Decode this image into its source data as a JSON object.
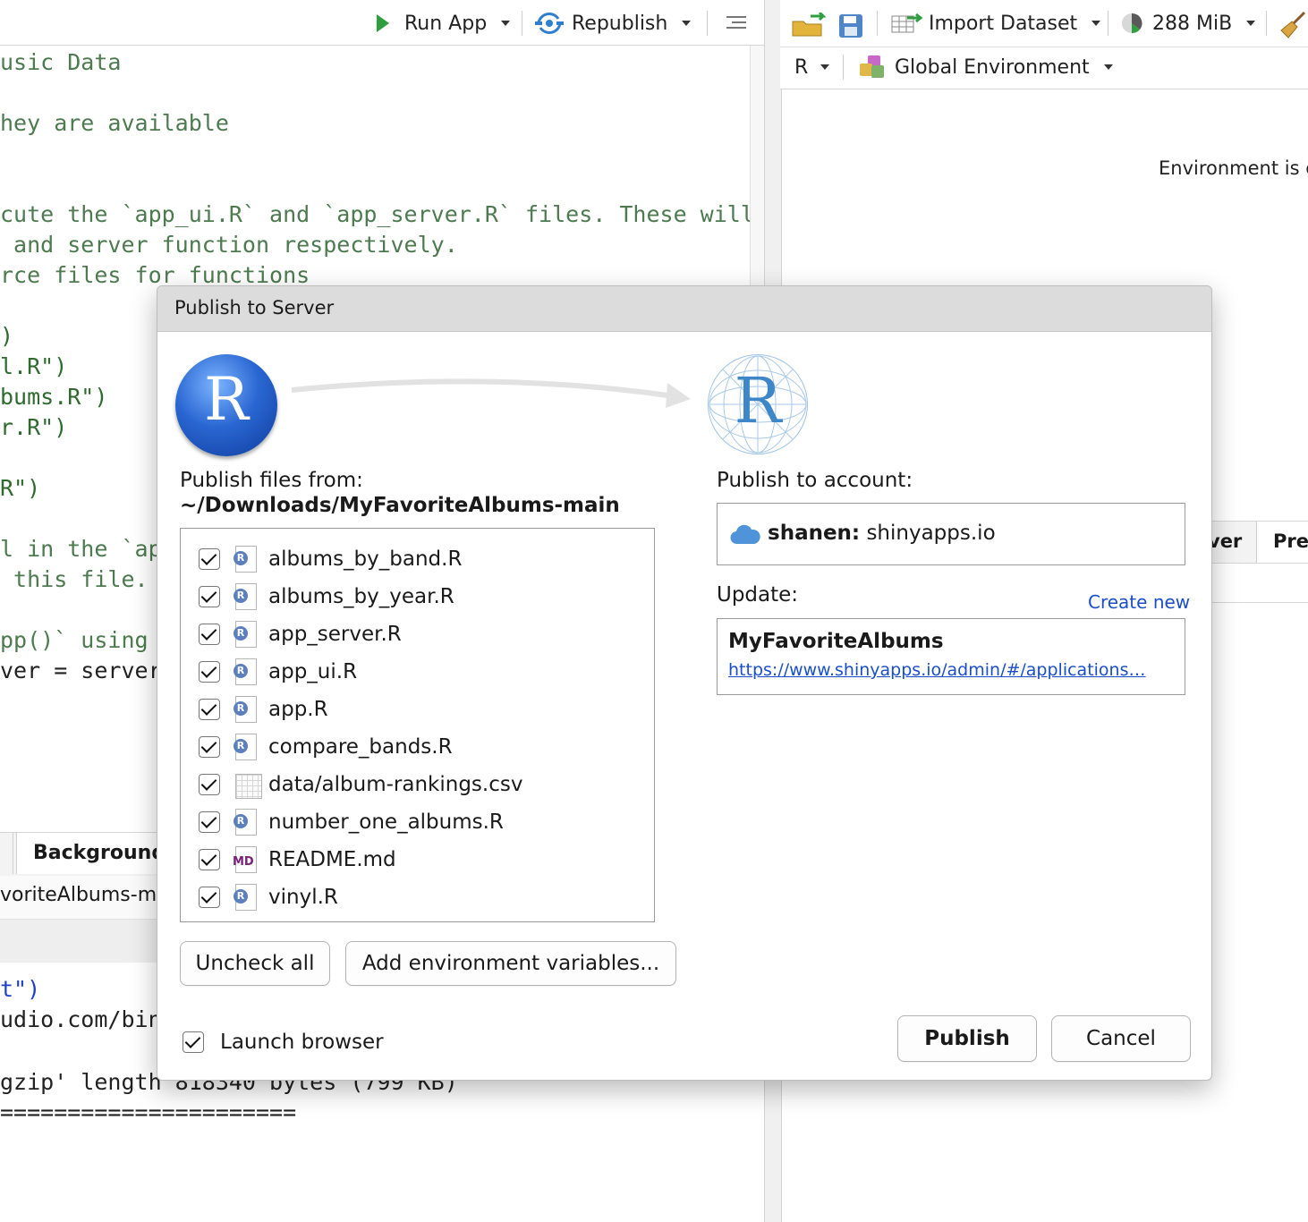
{
  "editor": {
    "toolbar": {
      "run_app_label": "Run App",
      "republish_label": "Republish"
    },
    "code_lines": [
      "usic Data",
      "",
      "hey are available",
      "",
      "",
      "cute the `app_ui.R` and `app_server.R` files. These will",
      " and server function respectively.",
      "rce files for functions",
      "",
      ")",
      "l.R\")",
      "bums.R\")",
      "r.R\")",
      "",
      "R\")",
      "",
      "l in the `ap",
      " this file.",
      "",
      "pp()` using",
      "ver = server)"
    ]
  },
  "console": {
    "tab_label": "Background",
    "path_fragment": "voriteAlbums-ma",
    "lines": [
      "t\")",
      "udio.com/bin/",
      "",
      "gzip' length 818340 bytes (799 KB)",
      "======================"
    ]
  },
  "environment": {
    "toolbar": {
      "import_dataset_label": "Import Dataset",
      "memory_label": "288 MiB",
      "language_label": "R",
      "environment_label": "Global Environment"
    },
    "empty_text": "Environment is e"
  },
  "files_pane": {
    "tabs": [
      "ver",
      "Pres"
    ]
  },
  "dialog": {
    "title": "Publish to Server",
    "publish_from_label": "Publish files from:",
    "publish_from_path": "~/Downloads/MyFavoriteAlbums-main",
    "files": [
      {
        "name": "albums_by_band.R",
        "type": "r",
        "checked": true
      },
      {
        "name": "albums_by_year.R",
        "type": "r",
        "checked": true
      },
      {
        "name": "app_server.R",
        "type": "r",
        "checked": true
      },
      {
        "name": "app_ui.R",
        "type": "r",
        "checked": true
      },
      {
        "name": "app.R",
        "type": "r",
        "checked": true
      },
      {
        "name": "compare_bands.R",
        "type": "r",
        "checked": true
      },
      {
        "name": "data/album-rankings.csv",
        "type": "csv",
        "checked": true
      },
      {
        "name": "number_one_albums.R",
        "type": "r",
        "checked": true
      },
      {
        "name": "README.md",
        "type": "md",
        "checked": true
      },
      {
        "name": "vinyl.R",
        "type": "r",
        "checked": true
      }
    ],
    "uncheck_all_label": "Uncheck all",
    "add_env_vars_label": "Add environment variables...",
    "launch_browser_label": "Launch browser",
    "launch_browser_checked": true,
    "publish_to_account_label": "Publish to account:",
    "account_user": "shanen:",
    "account_server": "shinyapps.io",
    "update_label": "Update:",
    "create_new_label": "Create new",
    "app_name": "MyFavoriteAlbums",
    "app_url": "https://www.shinyapps.io/admin/#/applications…",
    "publish_label": "Publish",
    "cancel_label": "Cancel",
    "logo_letter": "R",
    "md_badge": "MD"
  },
  "colors": {
    "link": "#1a4fc9",
    "code_comment": "#4d7a4f",
    "run_arrow": "#2e9e3e",
    "republish": "#2f7fd1"
  }
}
